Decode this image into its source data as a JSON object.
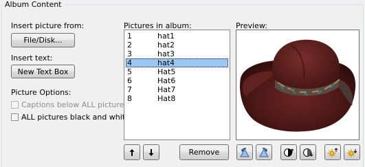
{
  "group": {
    "title": "Album Content"
  },
  "insert_picture": {
    "label": "Insert picture from:",
    "button": "File/Disk..."
  },
  "insert_text": {
    "label": "Insert text:",
    "button": "New Text Box"
  },
  "picture_options": {
    "label": "Picture Options:",
    "captions_label": "Captions below ALL pictures",
    "captions_checked": false,
    "captions_enabled": false,
    "bw_label": "ALL pictures black and white",
    "bw_checked": false
  },
  "pictures": {
    "label": "Pictures in album:",
    "items": [
      {
        "num": "1",
        "name": "hat1"
      },
      {
        "num": "2",
        "name": "hat2"
      },
      {
        "num": "3",
        "name": "hat3"
      },
      {
        "num": "4",
        "name": "hat4"
      },
      {
        "num": "5",
        "name": "Hat5"
      },
      {
        "num": "6",
        "name": "Hat6"
      },
      {
        "num": "7",
        "name": "Hat7"
      },
      {
        "num": "8",
        "name": "Hat8"
      }
    ],
    "selected_index": 3,
    "remove_button": "Remove"
  },
  "preview": {
    "label": "Preview:"
  },
  "colors": {
    "selection": "#99c8f5",
    "hat": "#5a1e1c"
  }
}
